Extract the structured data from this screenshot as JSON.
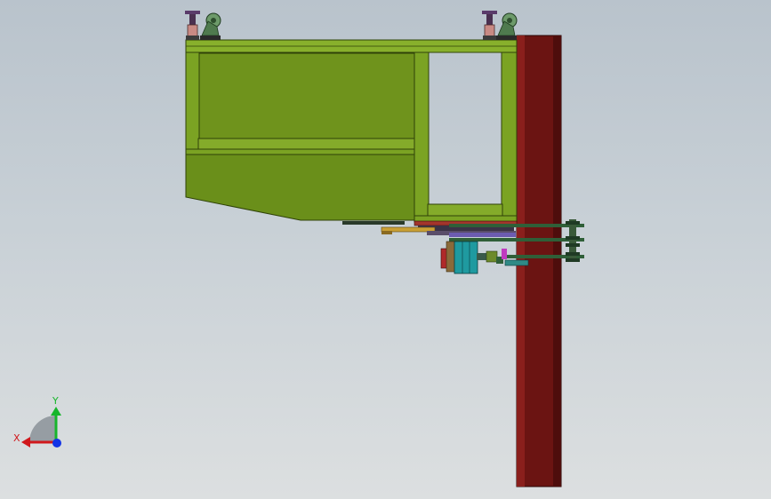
{
  "viewport": {
    "background_top": "#b9c3cc",
    "background_bottom": "#dcdfe0"
  },
  "model": {
    "frame_color": "#6f931c",
    "frame_edge_color": "#2f4208",
    "column_color": "#6b1412",
    "motor_color": "#1f9aa0"
  },
  "triad": {
    "x_label": "X",
    "y_label": "Y",
    "x_color": "#d0181c",
    "y_color": "#17b52b",
    "z_color": "#1233e6"
  }
}
